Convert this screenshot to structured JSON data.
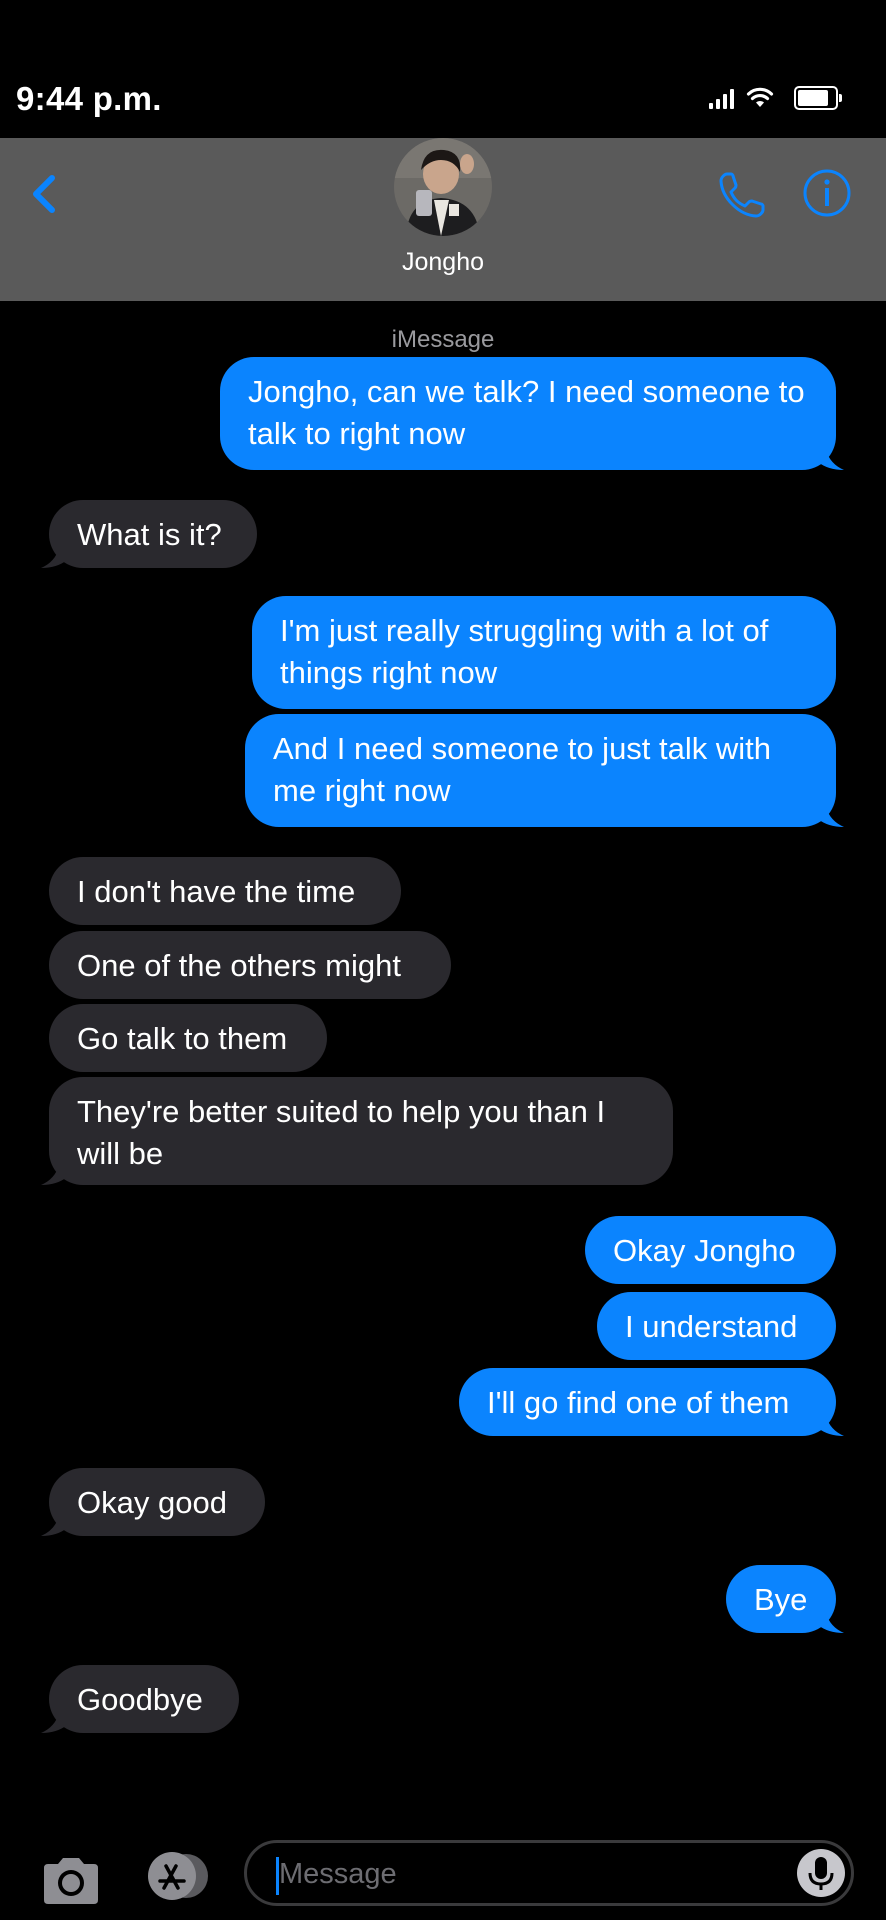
{
  "status_bar": {
    "time": "9:44 p.m."
  },
  "header": {
    "contact_name": "Jongho",
    "icons": {
      "back": "chevron-left-icon",
      "phone": "phone-icon",
      "info": "info-icon"
    },
    "accent_color": "#0b84fe",
    "background_color": "#5a5a5a"
  },
  "conversation": {
    "service_label": "iMessage",
    "messages": [
      {
        "from": "me",
        "text": "Jongho, can we talk? I need someone to talk to right now"
      },
      {
        "from": "them",
        "text": "What is it?"
      },
      {
        "from": "me",
        "text": "I'm just really struggling with a lot of things right now"
      },
      {
        "from": "me",
        "text": "And I need someone to just talk with me right now"
      },
      {
        "from": "them",
        "text": "I don't have the time"
      },
      {
        "from": "them",
        "text": "One of the others might"
      },
      {
        "from": "them",
        "text": "Go talk to them"
      },
      {
        "from": "them",
        "text": "They're better suited to help you than I will be"
      },
      {
        "from": "me",
        "text": "Okay Jongho"
      },
      {
        "from": "me",
        "text": "I understand"
      },
      {
        "from": "me",
        "text": "I'll go find one of them"
      },
      {
        "from": "them",
        "text": "Okay good"
      },
      {
        "from": "me",
        "text": "Bye"
      },
      {
        "from": "them",
        "text": "Goodbye"
      }
    ],
    "colors": {
      "outgoing": "#0b84fe",
      "incoming": "#2a292e"
    }
  },
  "input_bar": {
    "placeholder": "Message",
    "value": "",
    "icons": {
      "camera": "camera-icon",
      "apps": "app-store-icon",
      "mic": "microphone-icon"
    }
  }
}
